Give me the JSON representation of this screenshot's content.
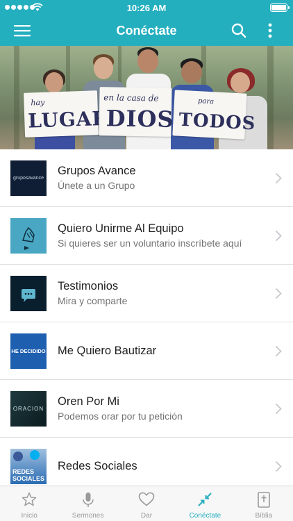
{
  "status_bar": {
    "time": "10:26 AM"
  },
  "header": {
    "title": "Conéctate",
    "menu_icon": "hamburger-menu-icon",
    "search_icon": "search-icon",
    "more_icon": "vertical-ellipsis-icon"
  },
  "hero": {
    "sign_left": {
      "small": "hay",
      "big": "LUGAR"
    },
    "sign_center": {
      "small": "en la casa de",
      "big": "DIOS"
    },
    "sign_right": {
      "small": "para",
      "big": "TODOS"
    }
  },
  "list_items": [
    {
      "title": "Grupos Avance",
      "subtitle": "Únete a un Grupo",
      "thumb_text": "gruposavance",
      "thumb_color": "#0f1e35"
    },
    {
      "title": "Quiero Unirme Al Equipo",
      "subtitle": "Si quieres ser un voluntario inscríbete aquí",
      "thumb_color": "#4aa7c4"
    },
    {
      "title": "Testimonios",
      "subtitle": "Mira y comparte",
      "thumb_color": "#0a1f2e"
    },
    {
      "title": "Me Quiero Bautizar",
      "subtitle": "",
      "thumb_text": "HE DECIDIDO",
      "thumb_color": "#1f5fb0"
    },
    {
      "title": "Oren Por Mi",
      "subtitle": "Podemos orar por tu petición",
      "thumb_text": "ORACION",
      "thumb_color": "#132a30"
    },
    {
      "title": "Redes Sociales",
      "subtitle": "",
      "thumb_text": "REDES SOCIALES",
      "thumb_color": "#2b6cb3"
    }
  ],
  "tabs": [
    {
      "label": "Inicio",
      "icon": "star-icon"
    },
    {
      "label": "Sermones",
      "icon": "microphone-icon"
    },
    {
      "label": "Dar",
      "icon": "heart-icon"
    },
    {
      "label": "Conéctate",
      "icon": "connect-arrows-icon",
      "active": true
    },
    {
      "label": "Biblia",
      "icon": "bible-icon"
    }
  ],
  "colors": {
    "accent": "#24afbf",
    "tab_inactive": "#9a9a9a"
  }
}
